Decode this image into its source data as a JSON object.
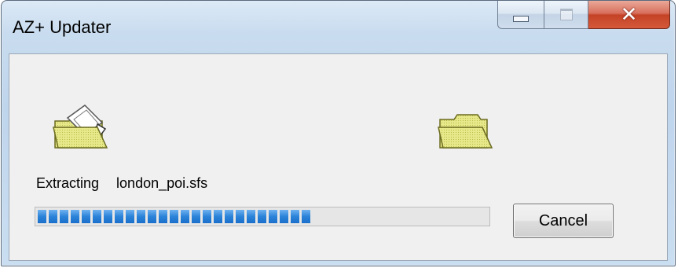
{
  "window": {
    "title": "AZ+ Updater",
    "caption_buttons": {
      "minimize_icon": "minimize-icon",
      "maximize_icon": "maximize-icon",
      "close_icon": "close-icon",
      "close_glyph": "✕"
    }
  },
  "status": {
    "action": "Extracting",
    "filename": "london_poi.sfs"
  },
  "progress": {
    "fraction": 0.61,
    "segments_filled": 25,
    "color": "#2b83d8"
  },
  "buttons": {
    "cancel_label": "Cancel"
  },
  "icons": {
    "source": "folder-open-icon",
    "destination": "folder-icon"
  }
}
